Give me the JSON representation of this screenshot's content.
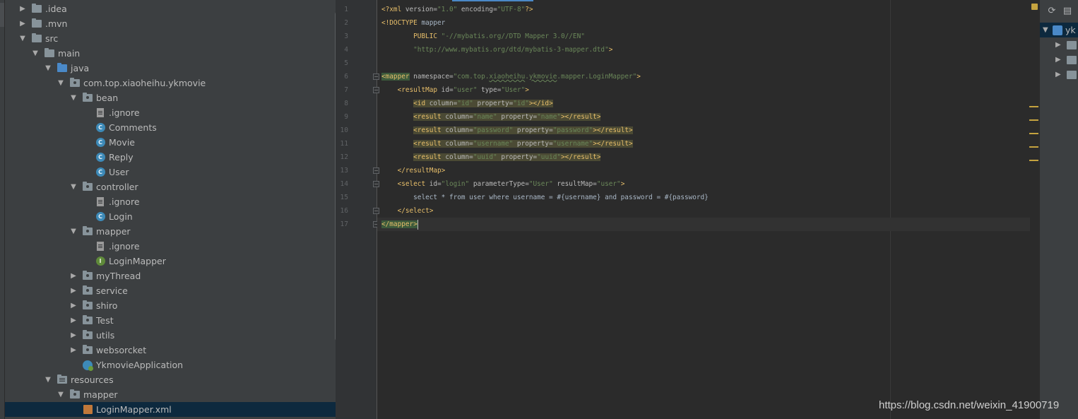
{
  "project_tree": [
    {
      "label": ".idea",
      "kind": "folder",
      "depth": 0,
      "expanded": false
    },
    {
      "label": ".mvn",
      "kind": "folder",
      "depth": 0,
      "expanded": false
    },
    {
      "label": "src",
      "kind": "folder",
      "depth": 0,
      "expanded": true
    },
    {
      "label": "main",
      "kind": "folder",
      "depth": 1,
      "expanded": true
    },
    {
      "label": "java",
      "kind": "source-folder",
      "depth": 2,
      "expanded": true
    },
    {
      "label": "com.top.xiaoheihu.ykmovie",
      "kind": "package",
      "depth": 3,
      "expanded": true
    },
    {
      "label": "bean",
      "kind": "package",
      "depth": 4,
      "expanded": true
    },
    {
      "label": ".ignore",
      "kind": "file",
      "depth": 5
    },
    {
      "label": "Comments",
      "kind": "class",
      "depth": 5
    },
    {
      "label": "Movie",
      "kind": "class",
      "depth": 5
    },
    {
      "label": "Reply",
      "kind": "class",
      "depth": 5
    },
    {
      "label": "User",
      "kind": "class",
      "depth": 5
    },
    {
      "label": "controller",
      "kind": "package",
      "depth": 4,
      "expanded": true
    },
    {
      "label": ".ignore",
      "kind": "file",
      "depth": 5
    },
    {
      "label": "Login",
      "kind": "class",
      "depth": 5
    },
    {
      "label": "mapper",
      "kind": "package",
      "depth": 4,
      "expanded": true
    },
    {
      "label": ".ignore",
      "kind": "file",
      "depth": 5
    },
    {
      "label": "LoginMapper",
      "kind": "interface",
      "depth": 5
    },
    {
      "label": "myThread",
      "kind": "package",
      "depth": 4,
      "expanded": false
    },
    {
      "label": "service",
      "kind": "package",
      "depth": 4,
      "expanded": false
    },
    {
      "label": "shiro",
      "kind": "package",
      "depth": 4,
      "expanded": false
    },
    {
      "label": "Test",
      "kind": "package",
      "depth": 4,
      "expanded": false
    },
    {
      "label": "utils",
      "kind": "package",
      "depth": 4,
      "expanded": false
    },
    {
      "label": "websorcket",
      "kind": "package",
      "depth": 4,
      "expanded": false
    },
    {
      "label": "YkmovieApplication",
      "kind": "app-class",
      "depth": 4
    },
    {
      "label": "resources",
      "kind": "resources-folder",
      "depth": 2,
      "expanded": true
    },
    {
      "label": "mapper",
      "kind": "package",
      "depth": 3,
      "expanded": true
    },
    {
      "label": "LoginMapper.xml",
      "kind": "xml-file",
      "depth": 4,
      "selected": true
    }
  ],
  "editor": {
    "line_numbers": [
      "1",
      "2",
      "3",
      "4",
      "5",
      "6",
      "7",
      "8",
      "9",
      "10",
      "11",
      "12",
      "13",
      "14",
      "15",
      "16",
      "17"
    ],
    "current_line": 17
  },
  "right_panel": {
    "root_label": "yk",
    "toolbar_icons": [
      "refresh-icon",
      "maven-goal-icon"
    ]
  },
  "watermark": "https://blog.csdn.net/weixin_41900719",
  "colors": {
    "tag": "#e8bf6a",
    "string": "#6a8759",
    "attribute": "#bababa",
    "selection": "#0d293e",
    "warning": "#c5a33f"
  }
}
